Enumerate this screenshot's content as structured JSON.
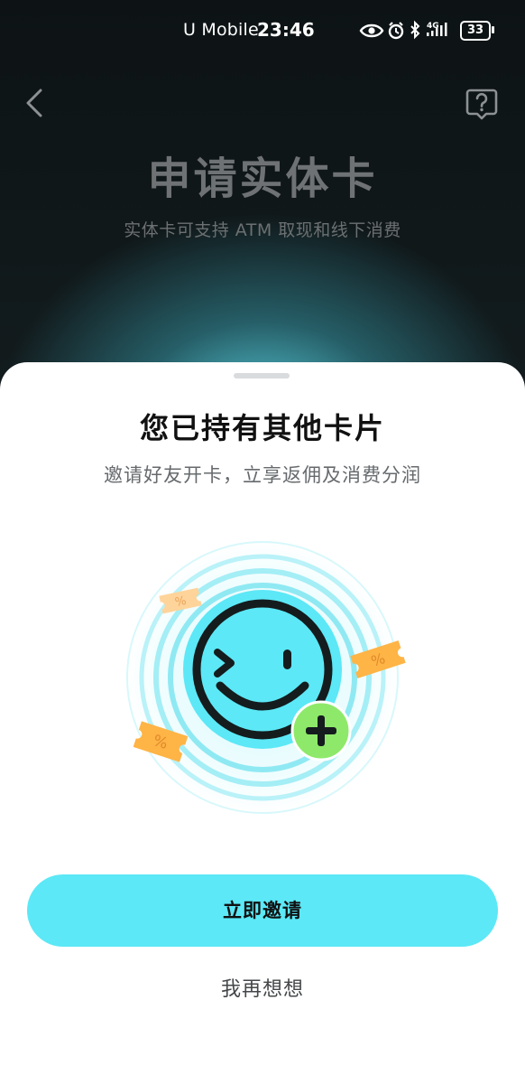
{
  "status_bar": {
    "carrier": "U Mobile",
    "time": "23:46",
    "network": "4G",
    "battery": "33",
    "icons": [
      "eye-icon",
      "alarm-icon",
      "bluetooth-icon",
      "signal-icon",
      "battery-icon"
    ]
  },
  "nav": {
    "back_icon": "chevron-left-icon",
    "help_icon": "help-bubble-icon"
  },
  "background_page": {
    "title": "申请实体卡",
    "subtitle": "实体卡可支持 ATM 取现和线下消费"
  },
  "sheet": {
    "title": "您已持有其他卡片",
    "subtitle": "邀请好友开卡，立享返佣及消费分润",
    "illustration_icons": [
      "smiley-face-icon",
      "add-plus-icon",
      "coupon-icon"
    ],
    "coupon_symbol": "%",
    "primary_button": "立即邀请",
    "secondary_button": "我再想想"
  },
  "colors": {
    "accent": "#5ce8f6",
    "plus_badge": "#8ee96a",
    "coupon": "#ffb446",
    "title_text": "#111111",
    "sheet_bg": "#ffffff"
  }
}
